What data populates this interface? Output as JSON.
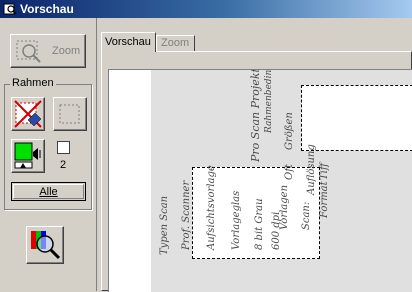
{
  "window": {
    "title": "Vorschau"
  },
  "left_panel": {
    "zoom_button": {
      "label": "Zoom"
    },
    "frame_group": {
      "label": "Rahmen",
      "frame_count": "2",
      "all_button": {
        "label": "Alle"
      }
    }
  },
  "tabs": [
    {
      "label": "Vorschau",
      "active": true
    },
    {
      "label": "Zoom",
      "active": false
    }
  ],
  "preview": {
    "handwriting": [
      "Pro Scan Projekt",
      "Rahmenbedingungen",
      "Vorlagen",
      "Oft",
      "Größen",
      "Scan:",
      "Auflösung",
      "Format",
      "Tiff",
      "Typen Scan",
      "Prof. Scanner",
      "Aufsichtsvorlage",
      "Vorlageglas",
      "8 bit Grau",
      "600 dpi"
    ]
  },
  "colors": {
    "face": "#d4d0c8",
    "title_start": "#0a246a",
    "title_end": "#a6caf0",
    "accent_green": "#00e000",
    "accent_red": "#d00000"
  }
}
